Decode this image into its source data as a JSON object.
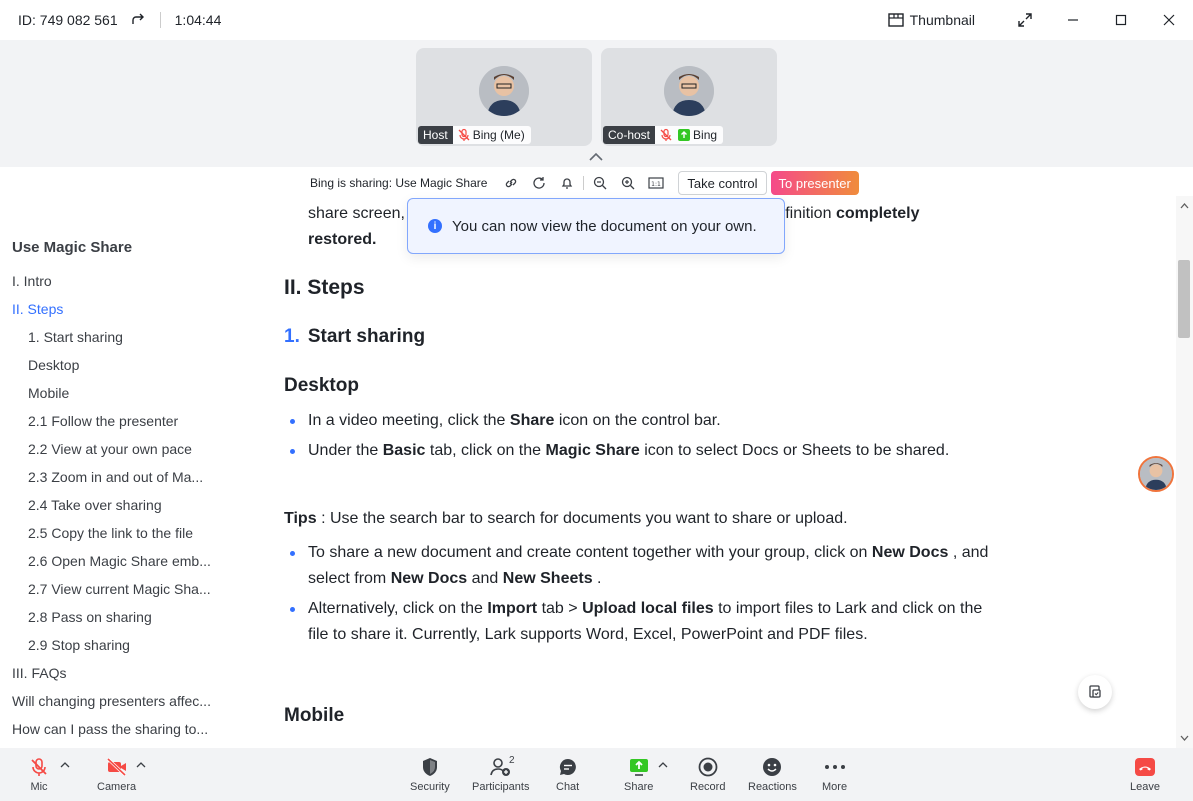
{
  "titlebar": {
    "meeting_id": "ID: 749 082 561",
    "timer": "1:04:44",
    "thumbnail_label": "Thumbnail"
  },
  "video": {
    "tiles": [
      {
        "role": "Host",
        "name": "Bing (Me)"
      },
      {
        "role": "Co-host",
        "name": "Bing"
      }
    ]
  },
  "share_toolbar": {
    "sharing_text": "Bing is sharing: Use Magic Share",
    "take_control": "Take control",
    "to_presenter": "To presenter"
  },
  "toast": {
    "message": "You can now view the document on your own."
  },
  "outline": {
    "title": "Use Magic Share",
    "items": [
      {
        "label": "I. Intro",
        "level": 1
      },
      {
        "label": "II. Steps",
        "level": 1,
        "active": true
      },
      {
        "label": "1. Start sharing",
        "level": 2
      },
      {
        "label": "Desktop",
        "level": 2
      },
      {
        "label": "Mobile",
        "level": 2
      },
      {
        "label": "2.1 Follow the presenter",
        "level": 2
      },
      {
        "label": "2.2 View at your own pace",
        "level": 2
      },
      {
        "label": "2.3 Zoom in and out of Ma...",
        "level": 2
      },
      {
        "label": "2.4 Take over sharing",
        "level": 2
      },
      {
        "label": "2.5 Copy the link to the file",
        "level": 2
      },
      {
        "label": "2.6 Open Magic Share emb...",
        "level": 2
      },
      {
        "label": "2.7 View current Magic Sha...",
        "level": 2
      },
      {
        "label": "2.8 Pass on sharing",
        "level": 2
      },
      {
        "label": "2.9 Stop sharing",
        "level": 2
      },
      {
        "label": "III. FAQs",
        "level": 1
      },
      {
        "label": "Will changing presenters affec...",
        "level": 1
      },
      {
        "label": "How can I pass the sharing to...",
        "level": 1
      }
    ]
  },
  "doc": {
    "cont_line1_a": "share screen,",
    "cont_line1_b": "with the definition",
    "cont_line1_bold": "completely",
    "cont_line2_bold": "restored.",
    "h_steps": "II. Steps",
    "h_start_num": "1.",
    "h_start": "Start sharing",
    "h_desktop": "Desktop",
    "d1_a": "In a video meeting, click the",
    "d1_b": "Share",
    "d1_c": "icon on the control bar.",
    "d2_a": "Under the",
    "d2_b": "Basic",
    "d2_c": "tab, click on the",
    "d2_d": "Magic Share",
    "d2_e": "icon to select Docs or Sheets to be shared.",
    "tips_b": "Tips",
    "tips_text": ": Use the search bar to search for documents you want to share or upload.",
    "t1_a": "To share a new document and create content together with your group, click on",
    "t1_b": "New Docs",
    "t1_c": ", and select from",
    "t1_d": "New Docs",
    "t1_e": "and",
    "t1_f": "New Sheets",
    "t1_g": ".",
    "t2_a": "Alternatively, click on the",
    "t2_b": "Import",
    "t2_c": "tab >",
    "t2_d": "Upload local files",
    "t2_e": "to import files to Lark and click on the file to share it. Currently, Lark supports Word, Excel, PowerPoint and PDF files.",
    "h_mobile": "Mobile"
  },
  "controlbar": {
    "mic": "Mic",
    "camera": "Camera",
    "security": "Security",
    "participants": "Participants",
    "participant_count": "2",
    "chat": "Chat",
    "share": "Share",
    "record": "Record",
    "reactions": "Reactions",
    "more": "More",
    "leave": "Leave"
  },
  "colors": {
    "accent": "#3370ff",
    "mic_off": "#f54a45",
    "share_green": "#34c724",
    "leave_red": "#f54a45"
  }
}
